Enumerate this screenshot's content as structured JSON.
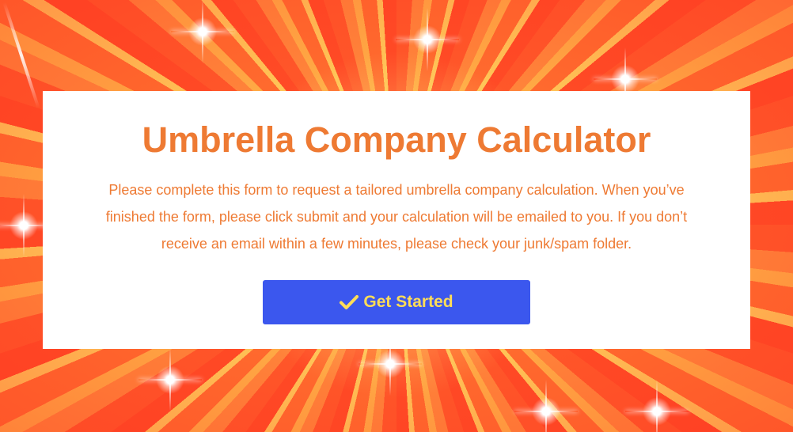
{
  "hero": {
    "title": "Umbrella Company Calculator",
    "description": "Please complete this form to request a tailored umbrella company calculation. When you’ve finished the form, please click submit and your calculation will be emailed to you. If you don’t receive an email within a few minutes, please check your junk/spam folder.",
    "button_label": "Get Started",
    "button_icon": "check-icon"
  },
  "colors": {
    "accent_text": "#ee7a33",
    "button_bg": "#3b57ee",
    "button_text": "#ffdd57",
    "card_bg": "#ffffff"
  }
}
